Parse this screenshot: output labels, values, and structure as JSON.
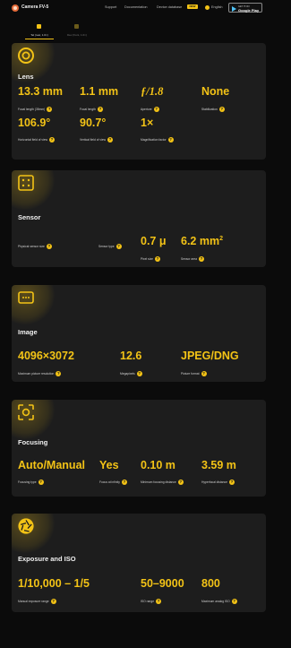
{
  "header": {
    "app_name": "Camera FV-5",
    "nav": [
      "Support",
      "Documentation",
      "Device database"
    ],
    "new_badge": "NEW",
    "language": "English",
    "store_small": "GET IT ON",
    "store_big": "Google Play"
  },
  "tabs": [
    {
      "label": "Tel (rear, 1.0×)",
      "active": true
    },
    {
      "label": "Dev (front, 1.0×)",
      "active": false
    }
  ],
  "help_glyph": "?",
  "lens": {
    "title": "Lens",
    "focal_35mm": {
      "value": "13.3 mm",
      "label": "Focal length (35mm)"
    },
    "focal": {
      "value": "1.1 mm",
      "label": "Focal length"
    },
    "aperture": {
      "value": "ƒ/1.8",
      "label": "Aperture"
    },
    "stabilization": {
      "value": "None",
      "label": "Stabilization"
    },
    "hfov": {
      "value": "106.9°",
      "label": "Horizontal field of view"
    },
    "vfov": {
      "value": "90.7°",
      "label": "Vertical field of view"
    },
    "magnification": {
      "value": "1×",
      "label": "Magnification factor"
    }
  },
  "sensor": {
    "title": "Sensor",
    "physical_size": {
      "label": "Physical sensor size"
    },
    "sensor_type": {
      "label": "Sensor type"
    },
    "pixel_size": {
      "value": "0.7 μ",
      "label": "Pixel size"
    },
    "sensor_area": {
      "value": "6.2 mm",
      "sup": "2",
      "label": "Sensor area"
    }
  },
  "image": {
    "title": "Image",
    "resolution": {
      "value": "4096×3072",
      "label": "Maximum picture resolution"
    },
    "megapixels": {
      "value": "12.6",
      "label": "Megapixels"
    },
    "format": {
      "value": "JPEG/DNG",
      "label": "Picture format"
    }
  },
  "focusing": {
    "title": "Focusing",
    "focusing_type": {
      "value": "Auto/Manual",
      "label": "Focusing type"
    },
    "focus_infinity": {
      "value": "Yes",
      "label": "Focus at infinity"
    },
    "min_distance": {
      "value": "0.10 m",
      "label": "Minimum focusing distance"
    },
    "hyperfocal": {
      "value": "3.59 m",
      "label": "Hyperfocal distance"
    }
  },
  "exposure": {
    "title": "Exposure and ISO",
    "manual_range": {
      "value": "1/10,000 – 1/5",
      "label": "Manual exposure range"
    },
    "iso_range": {
      "value": "50–9000",
      "label": "ISO range"
    },
    "max_analog_iso": {
      "value": "800",
      "label": "Maximum analog ISO"
    }
  }
}
